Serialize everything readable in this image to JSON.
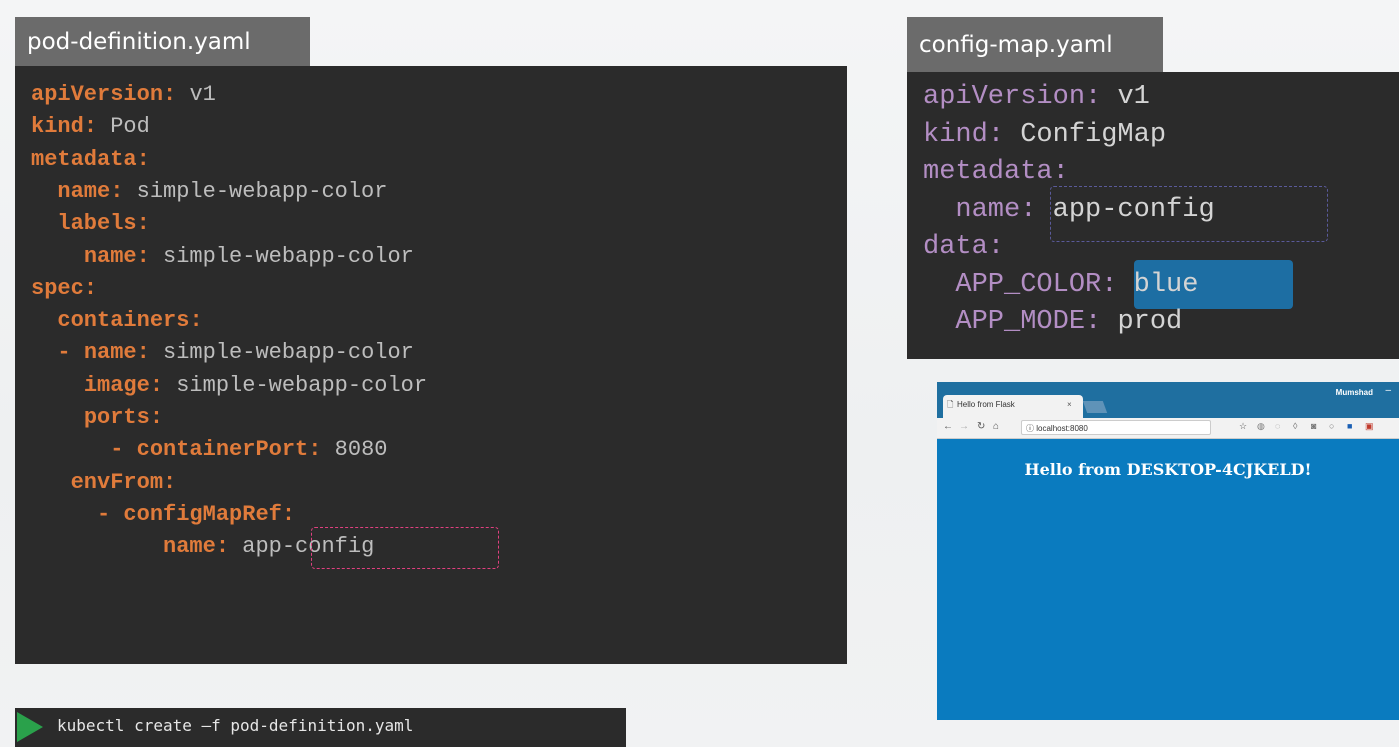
{
  "pod_file": {
    "tab_label": "pod-definition.yaml",
    "lines": [
      {
        "indent": "",
        "key": "apiVersion",
        "sep": ": ",
        "value": "v1"
      },
      {
        "indent": "",
        "key": "kind",
        "sep": ": ",
        "value": "Pod"
      },
      {
        "indent": "",
        "key": "metadata",
        "sep": ":",
        "value": ""
      },
      {
        "indent": "  ",
        "key": "name",
        "sep": ": ",
        "value": "simple-webapp-color"
      },
      {
        "indent": "  ",
        "key": "labels",
        "sep": ":",
        "value": ""
      },
      {
        "indent": "    ",
        "key": "name",
        "sep": ": ",
        "value": "simple-webapp-color"
      },
      {
        "indent": "",
        "key": "spec",
        "sep": ":",
        "value": ""
      },
      {
        "indent": "  ",
        "key": "containers",
        "sep": ":",
        "value": ""
      },
      {
        "indent": "  - ",
        "key": "name",
        "sep": ": ",
        "value": "simple-webapp-color"
      },
      {
        "indent": "    ",
        "key": "image",
        "sep": ": ",
        "value": "simple-webapp-color"
      },
      {
        "indent": "    ",
        "key": "ports",
        "sep": ":",
        "value": ""
      },
      {
        "indent": "      - ",
        "key": "containerPort",
        "sep": ": ",
        "value": "8080"
      },
      {
        "indent": "   ",
        "key": "envFrom",
        "sep": ":",
        "value": ""
      },
      {
        "indent": "     - ",
        "key": "configMapRef",
        "sep": ":",
        "value": ""
      },
      {
        "indent": "          ",
        "key": "name",
        "sep": ": ",
        "value": "app-config"
      }
    ],
    "highlight_color": "#e0407f"
  },
  "config_file": {
    "tab_label": "config-map.yaml",
    "lines": [
      {
        "indent": "",
        "key": "apiVersion",
        "sep": ": ",
        "value": "v1"
      },
      {
        "indent": "",
        "key": "kind",
        "sep": ": ",
        "value": "ConfigMap"
      },
      {
        "indent": "",
        "key": "metadata",
        "sep": ":",
        "value": ""
      },
      {
        "indent": "  ",
        "key": "name",
        "sep": ": ",
        "value": "app-config"
      },
      {
        "indent": "",
        "key": "data",
        "sep": ":",
        "value": ""
      },
      {
        "indent": "  ",
        "key": "APP_COLOR",
        "sep": ": ",
        "value": "blue"
      },
      {
        "indent": "  ",
        "key": "APP_MODE",
        "sep": ": ",
        "value": "prod"
      }
    ],
    "dash_color": "#5a5a9a",
    "highlight_color": "#1d6ea3"
  },
  "browser": {
    "tab_title": "Hello from Flask",
    "tab_close": "×",
    "user": "Mumshad",
    "minimize": "–",
    "url": "localhost:8080",
    "heading": "Hello from DESKTOP-4CJKELD!",
    "background": "#0a7bbf"
  },
  "command": {
    "text": "kubectl create –f pod-definition.yaml"
  }
}
